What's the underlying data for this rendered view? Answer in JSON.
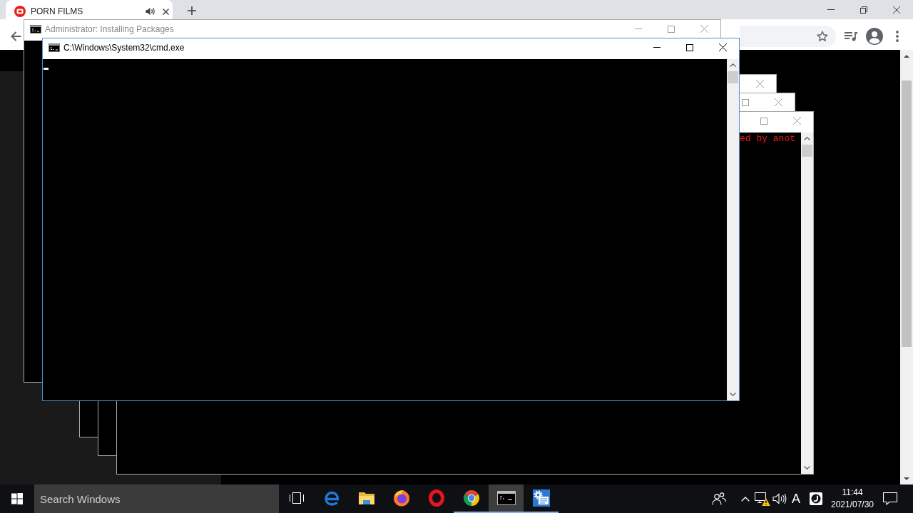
{
  "browser": {
    "tabs": [
      {
        "title": "PORN FILMS",
        "selected": true,
        "audible": true
      }
    ]
  },
  "windows": [
    {
      "title": "Administrator: Installing Packages",
      "active": false,
      "controls": [
        {
          "kind": "minimize"
        },
        {
          "kind": "maximize"
        },
        {
          "kind": "close"
        }
      ]
    },
    {
      "active": false,
      "controls": [
        {
          "kind": "close"
        }
      ]
    },
    {
      "active": false,
      "controls": [
        {
          "kind": "maximize"
        },
        {
          "kind": "close"
        }
      ]
    },
    {
      "active": false,
      "controls": [
        {
          "kind": "maximize"
        },
        {
          "kind": "close"
        }
      ],
      "scrollbar": true,
      "lines": [
        "ed by anot"
      ]
    },
    {
      "title": "C:\\Windows\\System32\\cmd.exe",
      "active": true,
      "controls": [
        {
          "kind": "minimize"
        },
        {
          "kind": "maximize"
        },
        {
          "kind": "close"
        }
      ],
      "scrollbar": true,
      "cursor": true
    }
  ],
  "taskbar": {
    "search": {
      "placeholder": "Search Windows"
    },
    "apps": [
      {
        "kind": "taskview",
        "running": false,
        "selected": false
      },
      {
        "kind": "elogo",
        "running": false,
        "selected": false
      },
      {
        "kind": "folder",
        "running": false,
        "selected": false
      },
      {
        "kind": "disclogo",
        "running": false,
        "selected": false
      },
      {
        "kind": "ring",
        "running": false,
        "selected": false
      },
      {
        "kind": "tricircle",
        "running": true,
        "selected": false
      },
      {
        "kind": "terminal",
        "running": true,
        "selected": true
      },
      {
        "kind": "gearwindow",
        "running": true,
        "selected": false
      }
    ],
    "tray": {
      "ime": "A"
    },
    "clock": {
      "time": "11:44",
      "date": "2021/07/30"
    }
  }
}
